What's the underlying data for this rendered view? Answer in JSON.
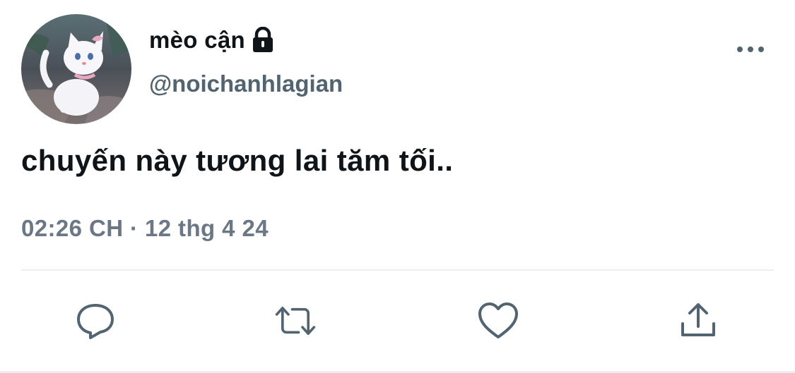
{
  "user": {
    "display_name": "mèo cận",
    "handle": "@noichanhlagian",
    "lock_icon": "lock-icon",
    "avatar": "avatar"
  },
  "tweet": {
    "text": "chuyến này tương lai tăm tối..",
    "time": "02:26 CH",
    "separator": "·",
    "date": "12 thg 4 24"
  },
  "actions": [
    {
      "icon": "reply-icon"
    },
    {
      "icon": "retweet-icon"
    },
    {
      "icon": "like-icon"
    },
    {
      "icon": "share-icon"
    }
  ],
  "menu": {
    "icon": "more-icon"
  },
  "colors": {
    "text_primary": "#0f1419",
    "text_secondary": "#536471",
    "icon": "#536471",
    "divider": "#eceef0"
  }
}
